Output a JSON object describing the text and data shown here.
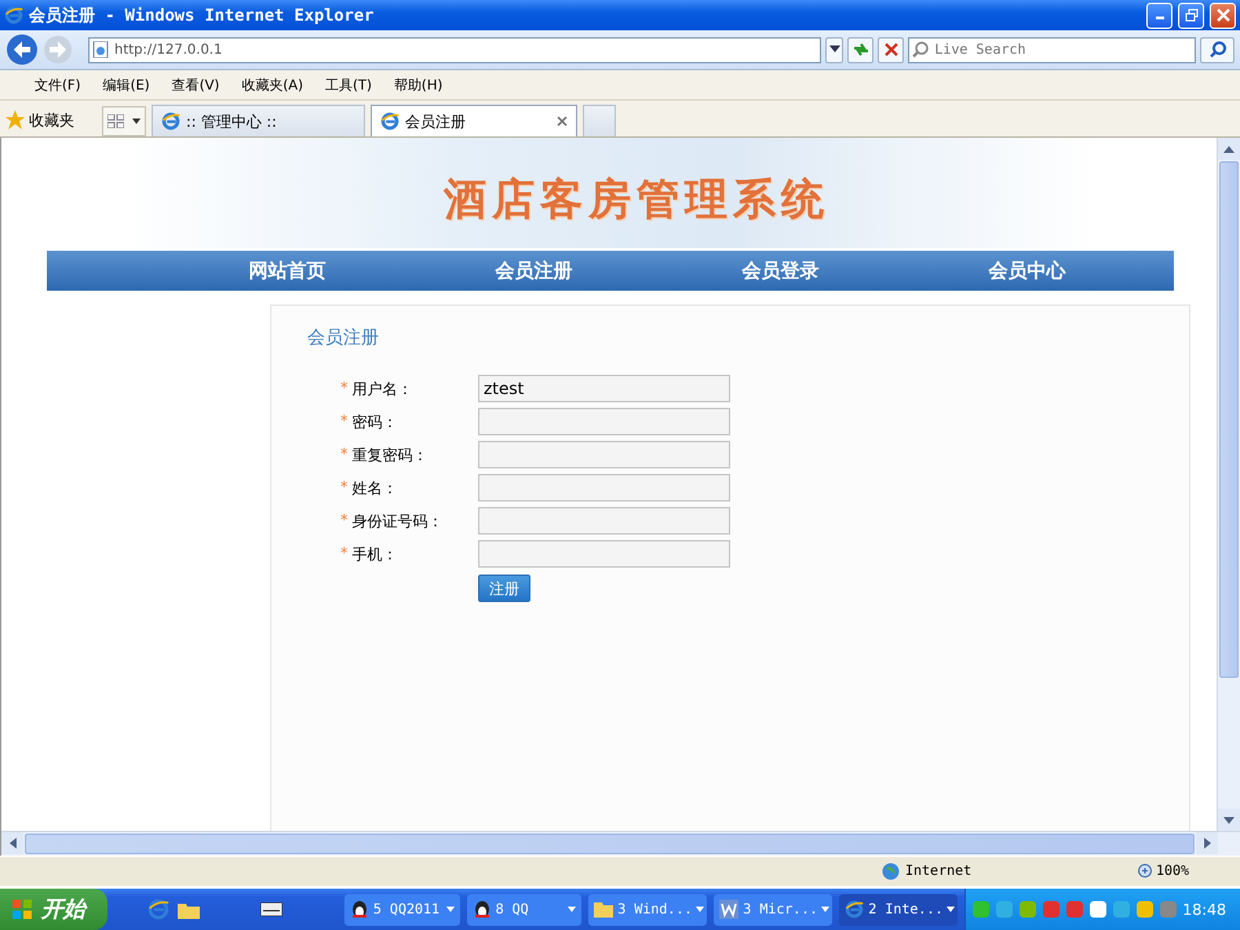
{
  "window": {
    "title": "会员注册 - Windows Internet Explorer"
  },
  "address_bar": {
    "value": "http://127.0.0.1"
  },
  "search": {
    "placeholder": "Live Search"
  },
  "menu": [
    "文件(F)",
    "编辑(E)",
    "查看(V)",
    "收藏夹(A)",
    "工具(T)",
    "帮助(H)"
  ],
  "favorites": {
    "label": "收藏夹"
  },
  "tabs": [
    {
      "label": ":: 管理中心 ::",
      "selected": false
    },
    {
      "label": "会员注册",
      "selected": true
    }
  ],
  "site": {
    "title": "酒店客房管理系统",
    "nav": [
      "网站首页",
      "会员注册",
      "会员登录",
      "会员中心"
    ]
  },
  "form": {
    "heading": "会员注册",
    "required_mark": "*",
    "fields": [
      {
        "label": "用户名：",
        "value": "ztest",
        "required": true
      },
      {
        "label": "密码：",
        "required": true
      },
      {
        "label": "重复密码：",
        "required": true
      },
      {
        "label": "姓名：",
        "required": true
      },
      {
        "label": "身份证号码：",
        "required": true
      },
      {
        "label": "手机：",
        "required": true
      }
    ],
    "submit": "注册"
  },
  "status_bar": {
    "zone": "Internet",
    "zoom": "100%"
  },
  "taskbar": {
    "start": "开始",
    "buttons": [
      {
        "label": "5 QQ2011",
        "kind": "penguin",
        "selected": false
      },
      {
        "label": "8 QQ",
        "kind": "penguin",
        "selected": false
      },
      {
        "label": "3 Wind...",
        "kind": "folder",
        "selected": false
      },
      {
        "label": "3 Micr...",
        "kind": "document",
        "selected": false
      },
      {
        "label": "2 Inte...",
        "kind": "browser",
        "selected": true
      }
    ],
    "clock": "18:48"
  }
}
